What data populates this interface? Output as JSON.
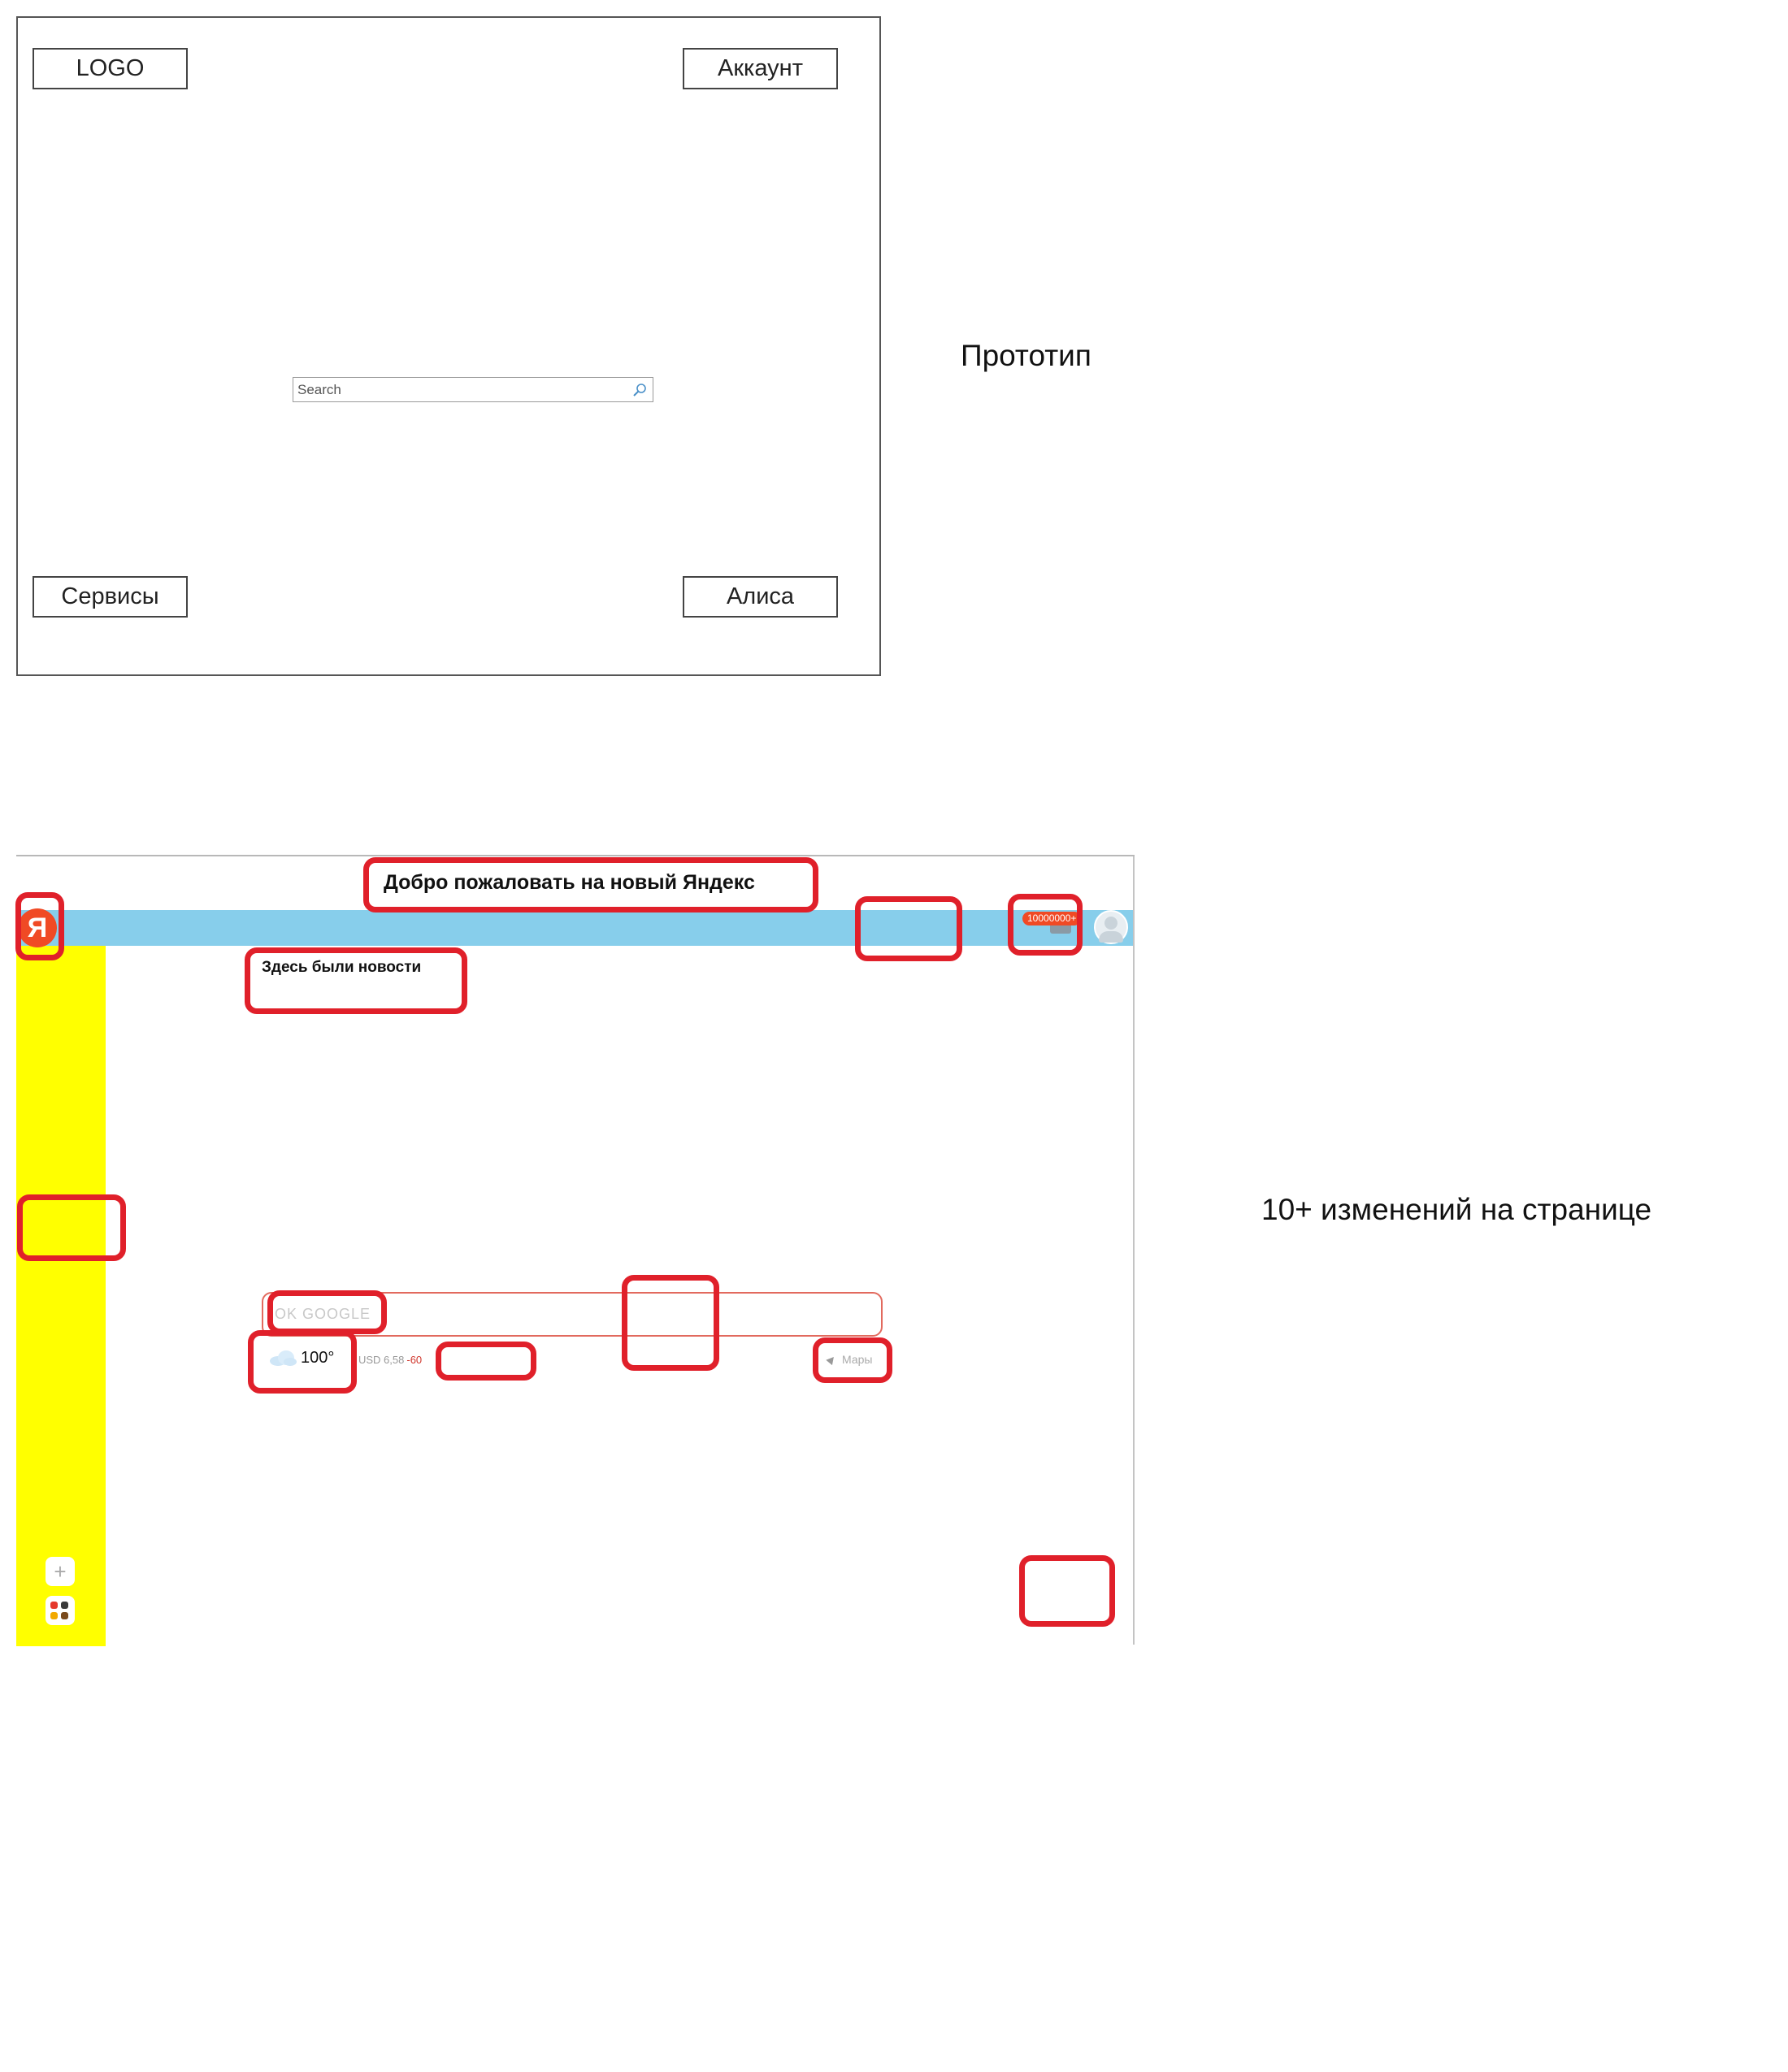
{
  "prototype": {
    "logo_label": "LOGO",
    "account_label": "Аккаунт",
    "search_placeholder": "Search",
    "services_label": "Сервисы",
    "alice_label": "Алиса",
    "caption": "Прототип"
  },
  "page": {
    "logo_letter": "Я",
    "welcome_text": "Добро пожаловать на новый Яндекс",
    "news_text": "Здесь были новости",
    "notification_count": "10000000+",
    "search_placeholder": "OK GOOGLE",
    "weather_temp": "100°",
    "currency_label": "USD 6,58",
    "currency_change": "-60",
    "maps_label": "Мары",
    "plus_symbol": "+"
  },
  "caption": "10+ изменений на странице",
  "colors": {
    "header_bar": "#87ceeb",
    "sidebar": "#ffff00",
    "highlight": "#e0202a",
    "yandex_red": "#f04a25"
  },
  "icons": [
    "search-icon",
    "yandex-logo-icon",
    "mail-icon",
    "avatar-icon",
    "cloud-icon",
    "location-arrow-icon",
    "plus-icon",
    "apps-icon"
  ]
}
